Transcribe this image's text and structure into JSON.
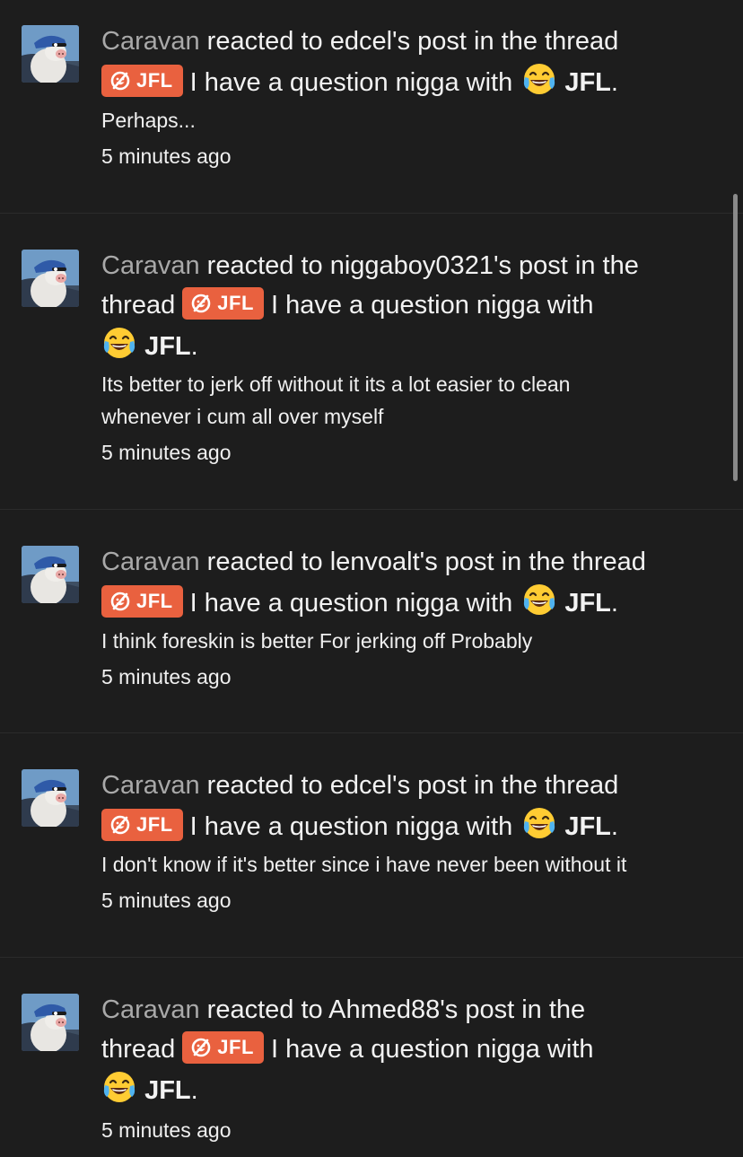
{
  "tag": {
    "label": "JFL",
    "color": "#e9613f"
  },
  "emoji": "face-with-tears-of-joy",
  "notifications": [
    {
      "user": "Caravan",
      "action_pre": " reacted to ",
      "target": "edcel's",
      "action_post": " post in the thread",
      "title": " I have a question nigga with ",
      "title_end": "JFL",
      "snippet": "Perhaps...",
      "time": "5 minutes ago"
    },
    {
      "user": "Caravan",
      "action_pre": " reacted to ",
      "target": "niggaboy0321's",
      "action_post": " post in the",
      "line2_prefix": "thread ",
      "title": " I have a question nigga with",
      "title_end": "JFL",
      "snippet_lines": [
        "Its better to jerk off without it its a lot easier to clean",
        "whenever i cum all over myself"
      ],
      "time": "5 minutes ago"
    },
    {
      "user": "Caravan",
      "action_pre": " reacted to ",
      "target": "lenvoalt's",
      "action_post": " post in the thread",
      "title": " I have a question nigga with ",
      "title_end": "JFL",
      "snippet": "I think foreskin is better For jerking off Probably",
      "time": "5 minutes ago"
    },
    {
      "user": "Caravan",
      "action_pre": " reacted to ",
      "target": "edcel's",
      "action_post": " post in the thread",
      "title": " I have a question nigga with ",
      "title_end": "JFL",
      "snippet": "I don't know if it's better since i have never been without it",
      "time": "5 minutes ago"
    },
    {
      "user": "Caravan",
      "action_pre": " reacted to ",
      "target": "Ahmed88's",
      "action_post": " post in the",
      "line2_prefix": "thread ",
      "title": " I have a question nigga with",
      "title_end": "JFL",
      "time": "5 minutes ago"
    }
  ]
}
